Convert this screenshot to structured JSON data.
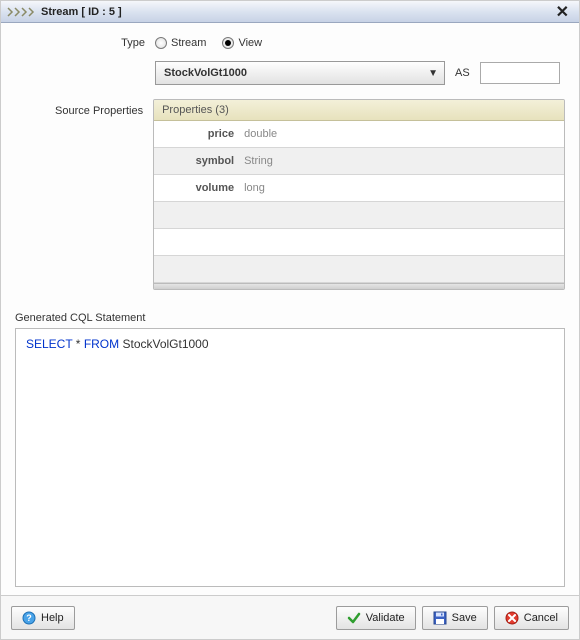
{
  "titlebar": {
    "title": "Stream [ ID : 5 ]"
  },
  "form": {
    "type_label": "Type",
    "radios": {
      "stream": {
        "label": "Stream",
        "selected": false
      },
      "view": {
        "label": "View",
        "selected": true
      }
    },
    "select_value": "StockVolGt1000",
    "as_label": "AS",
    "as_value": ""
  },
  "source_props": {
    "label": "Source Properties",
    "header": "Properties (3)",
    "rows": [
      {
        "name": "price",
        "type": "double"
      },
      {
        "name": "symbol",
        "type": "String"
      },
      {
        "name": "volume",
        "type": "long"
      }
    ]
  },
  "cql": {
    "label": "Generated CQL Statement",
    "kw_select": "SELECT",
    "star": " * ",
    "kw_from": "FROM",
    "rest": " StockVolGt1000"
  },
  "buttons": {
    "help": "Help",
    "validate": "Validate",
    "save": "Save",
    "cancel": "Cancel"
  }
}
